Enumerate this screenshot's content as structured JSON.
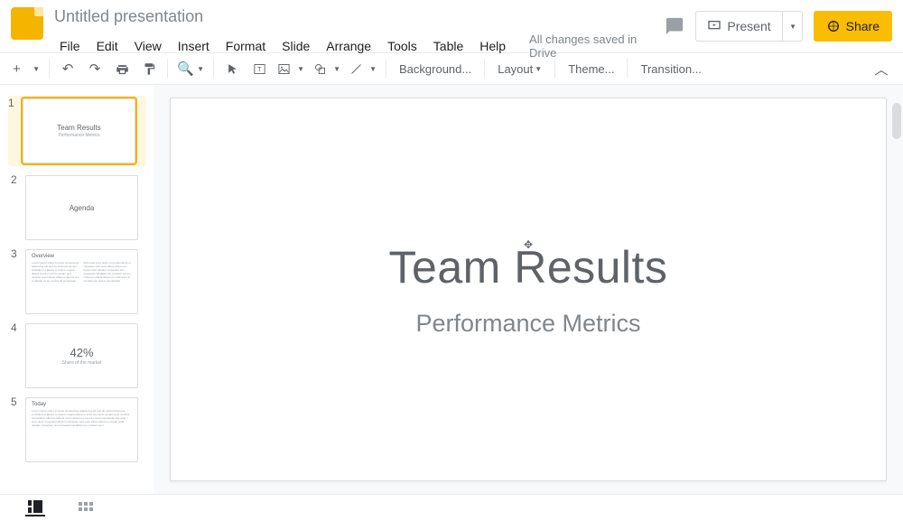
{
  "doc": {
    "title": "Untitled presentation",
    "save_status": "All changes saved in Drive"
  },
  "menu": {
    "file": "File",
    "edit": "Edit",
    "view": "View",
    "insert": "Insert",
    "format": "Format",
    "slide": "Slide",
    "arrange": "Arrange",
    "tools": "Tools",
    "table": "Table",
    "help": "Help"
  },
  "header_buttons": {
    "present": "Present",
    "share": "Share"
  },
  "toolbar_text": {
    "background": "Background...",
    "layout": "Layout",
    "theme": "Theme...",
    "transition": "Transition..."
  },
  "thumbnails": [
    {
      "num": "1",
      "type": "title",
      "title": "Team Results",
      "sub": "Performance Metrics",
      "selected": true
    },
    {
      "num": "2",
      "type": "title",
      "title": "Agenda",
      "sub": "",
      "selected": false
    },
    {
      "num": "3",
      "type": "twocol",
      "heading": "Overview",
      "selected": false
    },
    {
      "num": "4",
      "type": "big",
      "big": "42%",
      "sub": "Share of the market",
      "selected": false
    },
    {
      "num": "5",
      "type": "body",
      "heading": "Today",
      "selected": false
    }
  ],
  "slide": {
    "title": "Team Results",
    "subtitle": "Performance Metrics"
  }
}
